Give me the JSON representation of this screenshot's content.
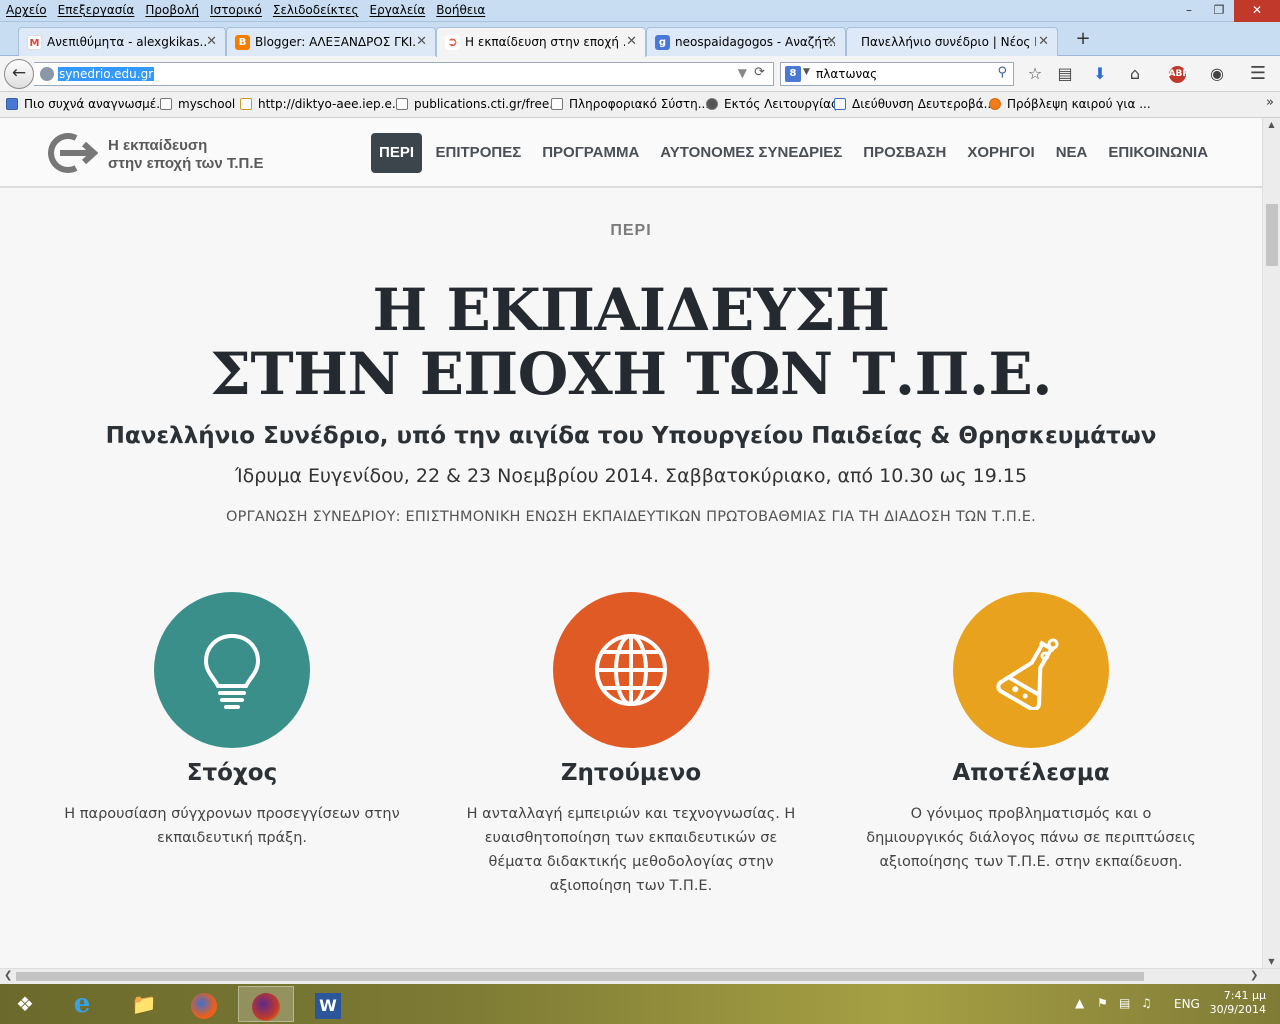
{
  "menubar": {
    "items": [
      "Αρχείο",
      "Επεξεργασία",
      "Προβολή",
      "Ιστορικό",
      "Σελιδοδείκτες",
      "Εργαλεία",
      "Βοήθεια"
    ]
  },
  "tabs": [
    {
      "label": "Ανεπιθύμητα - alexgkikas...",
      "icon": "M",
      "icon_color": "#d44638"
    },
    {
      "label": "Blogger: ΑΛΕΞΑΝΔΡΟΣ ΓΚΙ...",
      "icon": "B",
      "icon_color": "#f57d00"
    },
    {
      "label": "Η εκπαίδευση στην εποχή ...",
      "icon": "G",
      "icon_color": "#e8553e"
    },
    {
      "label": "neospaidagogos - Αναζήτ...",
      "icon": "g",
      "icon_color": "#4a78d6"
    },
    {
      "label": "Πανελλήνιο συνέδριο | Νέος Π...",
      "icon": "",
      "icon_color": "#dde9f6"
    }
  ],
  "navbar": {
    "url": "synedrio.edu.gr",
    "search_value": "πλατωνας"
  },
  "bookmarks": [
    "Πιο συχνά αναγνωσμέ...",
    "myschool",
    "http://diktyo-aee.iep.e...",
    "publications.cti.gr/free...",
    "Πληροφοριακό Σύστη...",
    "Εκτός Λειτουργίας",
    "Διεύθυνση Δευτεροβά...",
    "Πρόβλεψη καιρού για ..."
  ],
  "site": {
    "logo_line1": "Η εκπαίδευση",
    "logo_line2": "στην εποχή των Τ.Π.Ε",
    "nav": [
      "ΠΕΡΙ",
      "ΕΠΙΤΡΟΠΕΣ",
      "ΠΡΟΓΡΑΜΜΑ",
      "ΑΥΤΟΝΟΜΕΣ ΣΥΝΕΔΡΙΕΣ",
      "ΠΡΟΣΒΑΣΗ",
      "ΧΟΡΗΓΟΙ",
      "ΝΕΑ",
      "ΕΠΙΚΟΙΝΩΝΙΑ"
    ],
    "section_label": "ΠΕΡΙ",
    "hero_line1": "Η ΕΚΠΑΙΔΕΥΣΗ",
    "hero_line2": "ΣΤΗΝ ΕΠΟΧΗ ΤΩΝ Τ.Π.Ε.",
    "subtitle": "Πανελλήνιο Συνέδριο, υπό την αιγίδα του Υπουργείου Παιδείας & Θρησκευμάτων",
    "dates": "Ίδρυμα Ευγενίδου, 22 & 23 Νοεμβρίου 2014. Σαββατοκύριακο, από 10.30 ως 19.15",
    "organization": "ΟΡΓΑΝΩΣΗ ΣΥΝΕΔΡΙΟΥ: ΕΠΙΣΤΗΜΟΝΙΚΗ ΕΝΩΣΗ ΕΚΠΑΙΔΕΥΤΙΚΩΝ ΠΡΩΤΟΒΑΘΜΙΑΣ ΓΙΑ ΤΗ ΔΙΑΔΟΣΗ ΤΩΝ Τ.Π.Ε.",
    "features": [
      {
        "title": "Στόχος",
        "text": "Η παρουσίαση σύγχρονων προσεγγίσεων στην εκπαιδευτική πράξη.",
        "color": "#3a8f8a",
        "icon": "lightbulb-icon"
      },
      {
        "title": "Ζητούμενο",
        "text": "Η ανταλλαγή εμπειριών και τεχνογνωσίας. Η ευαισθητοποίηση των εκπαιδευτικών σε θέματα διδακτικής μεθοδολογίας στην αξιοποίηση των Τ.Π.Ε.",
        "color": "#e05a26",
        "icon": "globe-icon"
      },
      {
        "title": "Αποτέλεσμα",
        "text": "Ο γόνιμος προβληματισμός και ο δημιουργικός διάλογος πάνω σε περιπτώσεις αξιοποίησης των Τ.Π.Ε. στην εκπαίδευση.",
        "color": "#e8a21e",
        "icon": "flask-icon"
      }
    ]
  },
  "taskbar": {
    "lang": "ENG",
    "time": "7:41 μμ",
    "date": "30/9/2014"
  }
}
